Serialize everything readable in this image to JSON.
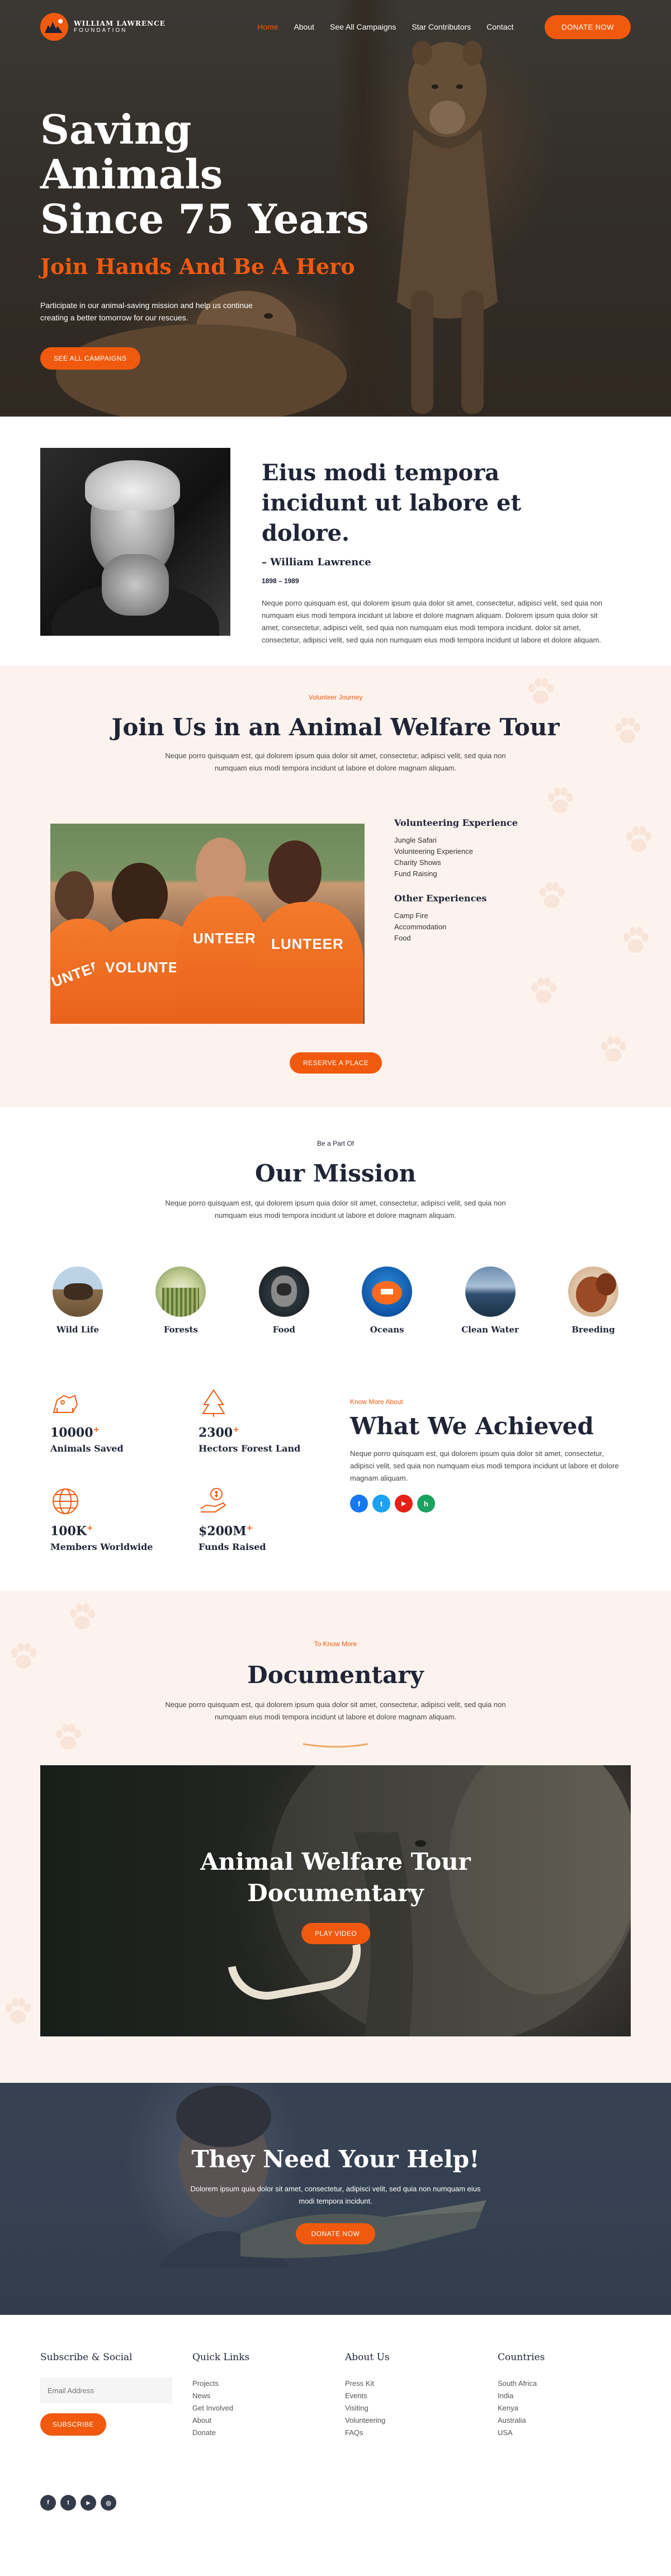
{
  "header": {
    "logo_line1": "WILLIAM LAWRENCE",
    "logo_line2": "FOUNDATION",
    "nav": [
      "Home",
      "About",
      "See All Campaigns",
      "Star Contributors",
      "Contact"
    ],
    "donate_button": "DONATE NOW"
  },
  "hero": {
    "title_line1": "Saving Animals",
    "title_line2": "Since 75 Years",
    "subtitle": "Join Hands And Be A Hero",
    "description": "Participate in our animal-saving mission and help us continue creating a better tomorrow for our rescues.",
    "cta": "SEE ALL CAMPAIGNS"
  },
  "quote": {
    "title": "Eius modi tempora incidunt ut labore et dolore.",
    "author": "– William Lawrence",
    "years": "1898 – 1989",
    "body": "Neque porro quisquam est, qui dolorem ipsum quia dolor sit amet, consectetur, adipisci velit, sed quia non numquam eius modi tempora incidunt ut labore et dolore magnam aliquam. Dolorem ipsum quia dolor sit amet, consectetur, adipisci velit, sed quia non numquam eius modi tempora incidunt. dolor sit amet, consectetur, adipisci velit, sed quia non numquam eius modi tempora incidunt ut labore et dolore aliquam."
  },
  "volunteer": {
    "kicker": "Volunteer Journey",
    "title": "Join Us in an Animal Welfare Tour",
    "description": "Neque porro quisquam est, qui dolorem ipsum quia dolor sit amet, consectetur, adipisci velit, sed quia non numquam eius modi tempora incidunt ut labore et dolore magnam aliquam.",
    "group1_title": "Volunteering Experience",
    "group1_items": [
      "Jungle Safari",
      "Volunteering Experience",
      "Charity Shows",
      "Fund Raising"
    ],
    "group2_title": "Other Experiences",
    "group2_items": [
      "Camp Fire",
      "Accommodation",
      "Food"
    ],
    "shirt_text_1": "VOLUNTEER",
    "shirt_text_2": "UNTEER",
    "shirt_text_3": "LUNTEER",
    "cta": "RESERVE A PLACE"
  },
  "mission": {
    "kicker": "Be a Part Of",
    "title": "Our Mission",
    "description": "Neque porro quisquam est, qui dolorem ipsum quia dolor sit amet, consectetur, adipisci velit, sed quia non numquam eius modi tempora incidunt ut labore et dolore magnam aliquam.",
    "items": [
      "Wild Life",
      "Forests",
      "Food",
      "Oceans",
      "Clean Water",
      "Breeding"
    ]
  },
  "achieved": {
    "stats": [
      {
        "number": "10000",
        "suffix": "+",
        "label": "Animals Saved"
      },
      {
        "number": "2300",
        "suffix": "+",
        "label": "Hectors Forest Land"
      },
      {
        "number": "100K",
        "suffix": "+",
        "label": "Members Worldwide"
      },
      {
        "number": "$200M",
        "suffix": "+",
        "label": "Funds Raised"
      }
    ],
    "kicker": "Know More About",
    "title": "What We Achieved",
    "description": "Neque porro quisquam est, qui dolorem ipsum quia dolor sit amet, consectetur, adipisci velit, sed quia non numquam eius modi tempora incidunt ut labore et dolore magnam aliquam.",
    "socials": [
      "f",
      "t",
      "▶",
      "h"
    ]
  },
  "documentary": {
    "kicker": "To Know More",
    "title": "Documentary",
    "description": "Neque porro quisquam est, qui dolorem ipsum quia dolor sit amet, consectetur, adipisci velit, sed quia non numquam eius modi tempora incidunt ut labore et dolore magnam aliquam.",
    "video_title_line1": "Animal Welfare Tour",
    "video_title_line2": "Documentary",
    "play_button": "PLAY VIDEO"
  },
  "help": {
    "title": "They Need Your Help!",
    "description": "Dolorem ipsum quia dolor sit amet, consectetur, adipisci velit, sed quia non numquam eius modi tempora incidunt.",
    "cta": "DONATE NOW"
  },
  "footer": {
    "subscribe_title": "Subscribe & Social",
    "email_placeholder": "Email Address",
    "subscribe_button": "SUBSCRIBE",
    "quick_links_title": "Quick Links",
    "quick_links": [
      "Projects",
      "News",
      "Get Involved",
      "About",
      "Donate"
    ],
    "about_title": "About Us",
    "about_links": [
      "Press Kit",
      "Events",
      "Visiting",
      "Volunteering",
      "FAQs"
    ],
    "countries_title": "Countries",
    "countries": [
      "South Africa",
      "India",
      "Kenya",
      "Australia",
      "USA"
    ],
    "socials": [
      "f",
      "t",
      "▶",
      "◎"
    ]
  },
  "colors": {
    "accent": "#f15a0e",
    "dark_text": "#1f2437",
    "peach_bg": "#fdf3ee"
  }
}
